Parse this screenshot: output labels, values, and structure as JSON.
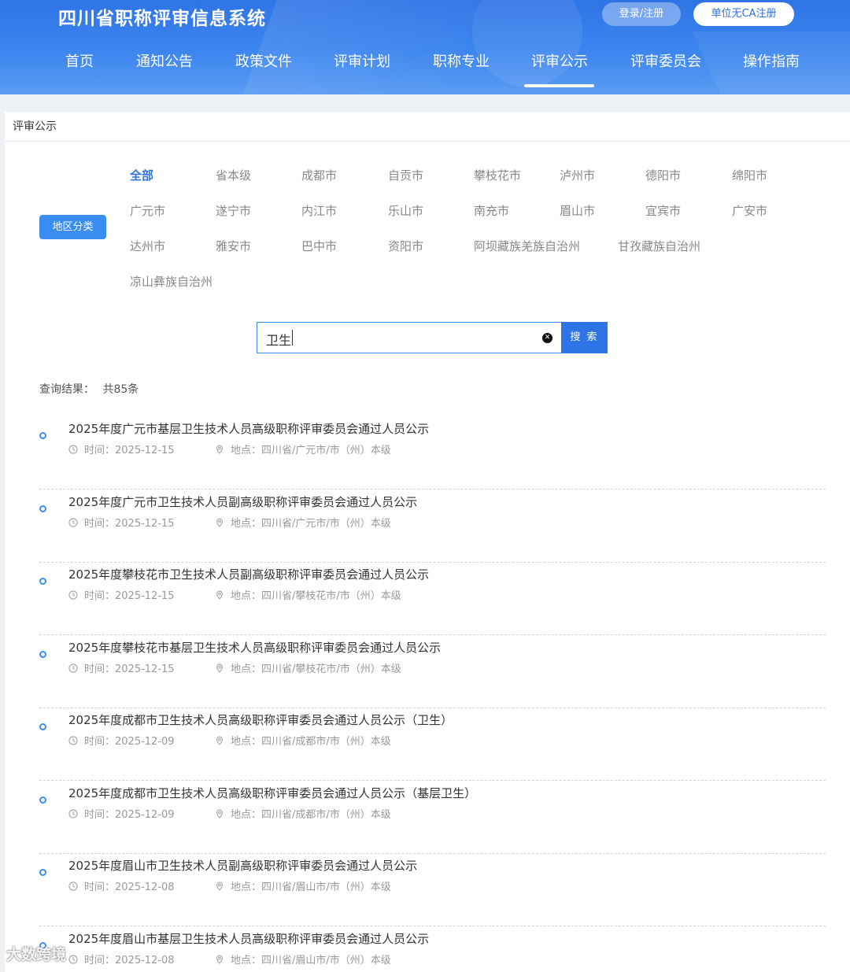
{
  "header": {
    "site_title": "四川省职称评审信息系统",
    "login_label": "登录/注册",
    "ca_label": "单位无CA注册",
    "nav": [
      "首页",
      "通知公告",
      "政策文件",
      "评审计划",
      "职称专业",
      "评审公示",
      "评审委员会",
      "操作指南"
    ],
    "active_nav": "评审公示"
  },
  "panel": {
    "title": "评审公示",
    "region_button": "地区分类",
    "regions": [
      "全部",
      "省本级",
      "成都市",
      "自贡市",
      "攀枝花市",
      "泸州市",
      "德阳市",
      "绵阳市",
      "广元市",
      "遂宁市",
      "内江市",
      "乐山市",
      "南充市",
      "眉山市",
      "宜宾市",
      "广安市",
      "达州市",
      "雅安市",
      "巴中市",
      "资阳市",
      "阿坝藏族羌族自治州",
      "甘孜藏族自治州",
      "凉山彝族自治州"
    ],
    "active_region": "全部"
  },
  "search": {
    "value": "卫生",
    "button_label": "搜 索"
  },
  "results": {
    "label": "查询结果：",
    "count": "共85条",
    "time_prefix": "时间：",
    "place_prefix": "地点：",
    "items": [
      {
        "title": "2025年度广元市基层卫生技术人员高级职称评审委员会通过人员公示",
        "time": "2025-12-15",
        "place": "四川省/广元市/市（州）本级"
      },
      {
        "title": "2025年度广元市卫生技术人员副高级职称评审委员会通过人员公示",
        "time": "2025-12-15",
        "place": "四川省/广元市/市（州）本级"
      },
      {
        "title": "2025年度攀枝花市卫生技术人员副高级职称评审委员会通过人员公示",
        "time": "2025-12-15",
        "place": "四川省/攀枝花市/市（州）本级"
      },
      {
        "title": "2025年度攀枝花市基层卫生技术人员高级职称评审委员会通过人员公示",
        "time": "2025-12-15",
        "place": "四川省/攀枝花市/市（州）本级"
      },
      {
        "title": "2025年度成都市卫生技术人员高级职称评审委员会通过人员公示（卫生）",
        "time": "2025-12-09",
        "place": "四川省/成都市/市（州）本级"
      },
      {
        "title": "2025年度成都市卫生技术人员高级职称评审委员会通过人员公示（基层卫生）",
        "time": "2025-12-09",
        "place": "四川省/成都市/市（州）本级"
      },
      {
        "title": "2025年度眉山市卫生技术人员副高级职称评审委员会通过人员公示",
        "time": "2025-12-08",
        "place": "四川省/眉山市/市（州）本级"
      },
      {
        "title": "2025年度眉山市基层卫生技术人员高级职称评审委员会通过人员公示",
        "time": "2025-12-08",
        "place": "四川省/眉山市/市（州）本级"
      }
    ]
  },
  "watermark": "大数跨境",
  "colors": {
    "primary": "#2f74e6",
    "accent": "#3a8ef2"
  }
}
